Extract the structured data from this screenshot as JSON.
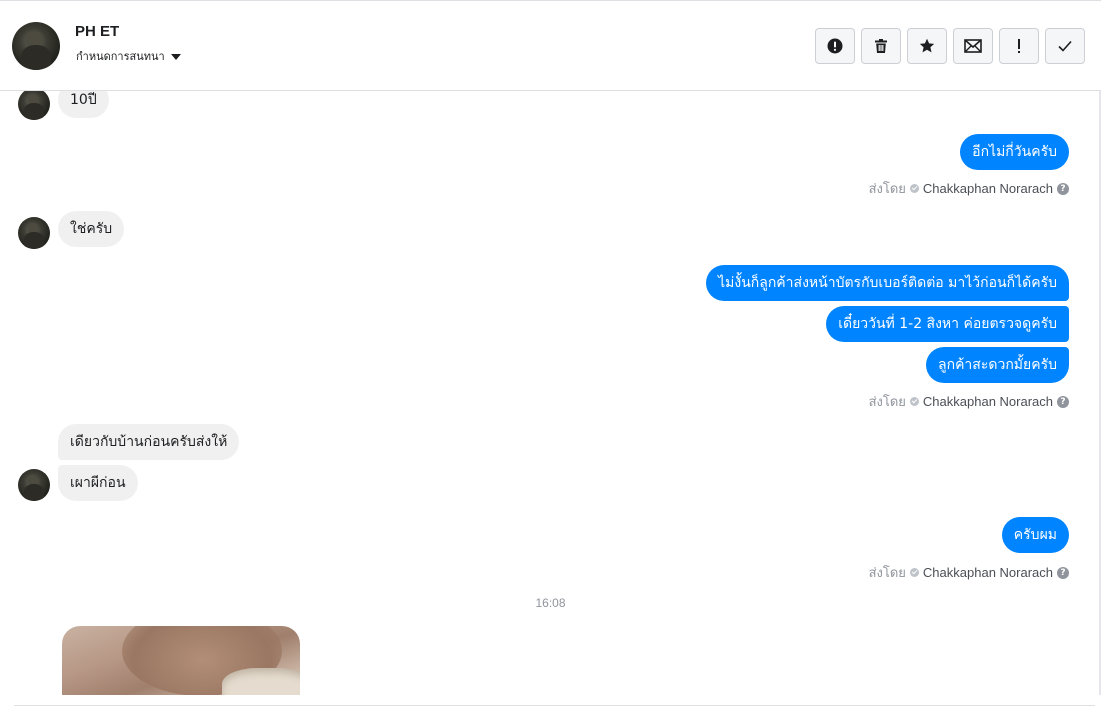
{
  "header": {
    "contact_name": "PH ET",
    "assign_label": "กำหนดการสนทนา",
    "toolbar": [
      {
        "name": "mark-spam-button",
        "icon": "alert-circle-icon"
      },
      {
        "name": "delete-button",
        "icon": "trash-icon"
      },
      {
        "name": "star-button",
        "icon": "star-icon"
      },
      {
        "name": "mark-unread-button",
        "icon": "envelope-icon"
      },
      {
        "name": "follow-up-button",
        "icon": "exclamation-icon"
      },
      {
        "name": "mark-done-button",
        "icon": "check-icon"
      }
    ]
  },
  "messages": {
    "in_1": "10ปี",
    "out_1": "อีกไม่กี่วันครับ",
    "sent_by_1": {
      "prefix": "ส่งโดย",
      "agent": "Chakkaphan Norarach"
    },
    "in_2": "ใช่ครับ",
    "out_2": "ไม่งั้นก็ลูกค้าส่งหน้าบัตรกับเบอร์ติดต่อ มาไว้ก่อนก็ได้ครับ",
    "out_3": "เดี๋ยววันที่ 1-2 สิงหา ค่อยตรวจดูครับ",
    "out_4": "ลูกค้าสะดวกมั้ยครับ",
    "sent_by_2": {
      "prefix": "ส่งโดย",
      "agent": "Chakkaphan Norarach"
    },
    "in_3": "เดียวกับบ้านก่อนครับส่งให้",
    "in_4": "เผาผีก่อน",
    "out_5": "ครับผม",
    "sent_by_3": {
      "prefix": "ส่งโดย",
      "agent": "Chakkaphan Norarach"
    },
    "timestamp": "16:08"
  },
  "colors": {
    "outgoing_bubble": "#0084ff",
    "incoming_bubble": "#f1f0f0",
    "meta_text": "#90949c"
  }
}
